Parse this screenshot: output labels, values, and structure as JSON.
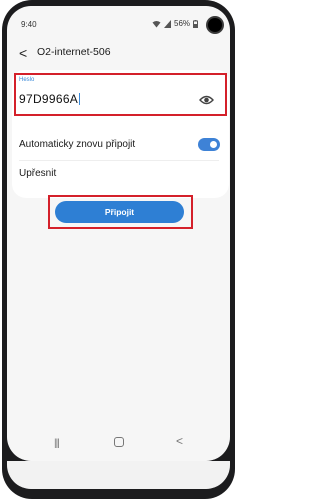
{
  "status_bar": {
    "time": "9:40",
    "battery": "56%"
  },
  "header": {
    "back_glyph": "<",
    "title": "O2-internet-506"
  },
  "password": {
    "label": "Heslo",
    "value": "97D9966A"
  },
  "settings": {
    "auto_reconnect_label": "Automaticky znovu připojit",
    "auto_reconnect_on": true,
    "advanced_label": "Upřesnit"
  },
  "connect_button": {
    "label": "Připojit"
  },
  "colors": {
    "accent": "#2e7fd4",
    "highlight": "#d4202a",
    "label_blue": "#3b8ad9"
  },
  "icons": [
    "back-icon",
    "eye-icon",
    "wifi-icon",
    "signal-icon",
    "battery-icon",
    "recent-apps-icon",
    "home-icon",
    "nav-back-icon"
  ]
}
